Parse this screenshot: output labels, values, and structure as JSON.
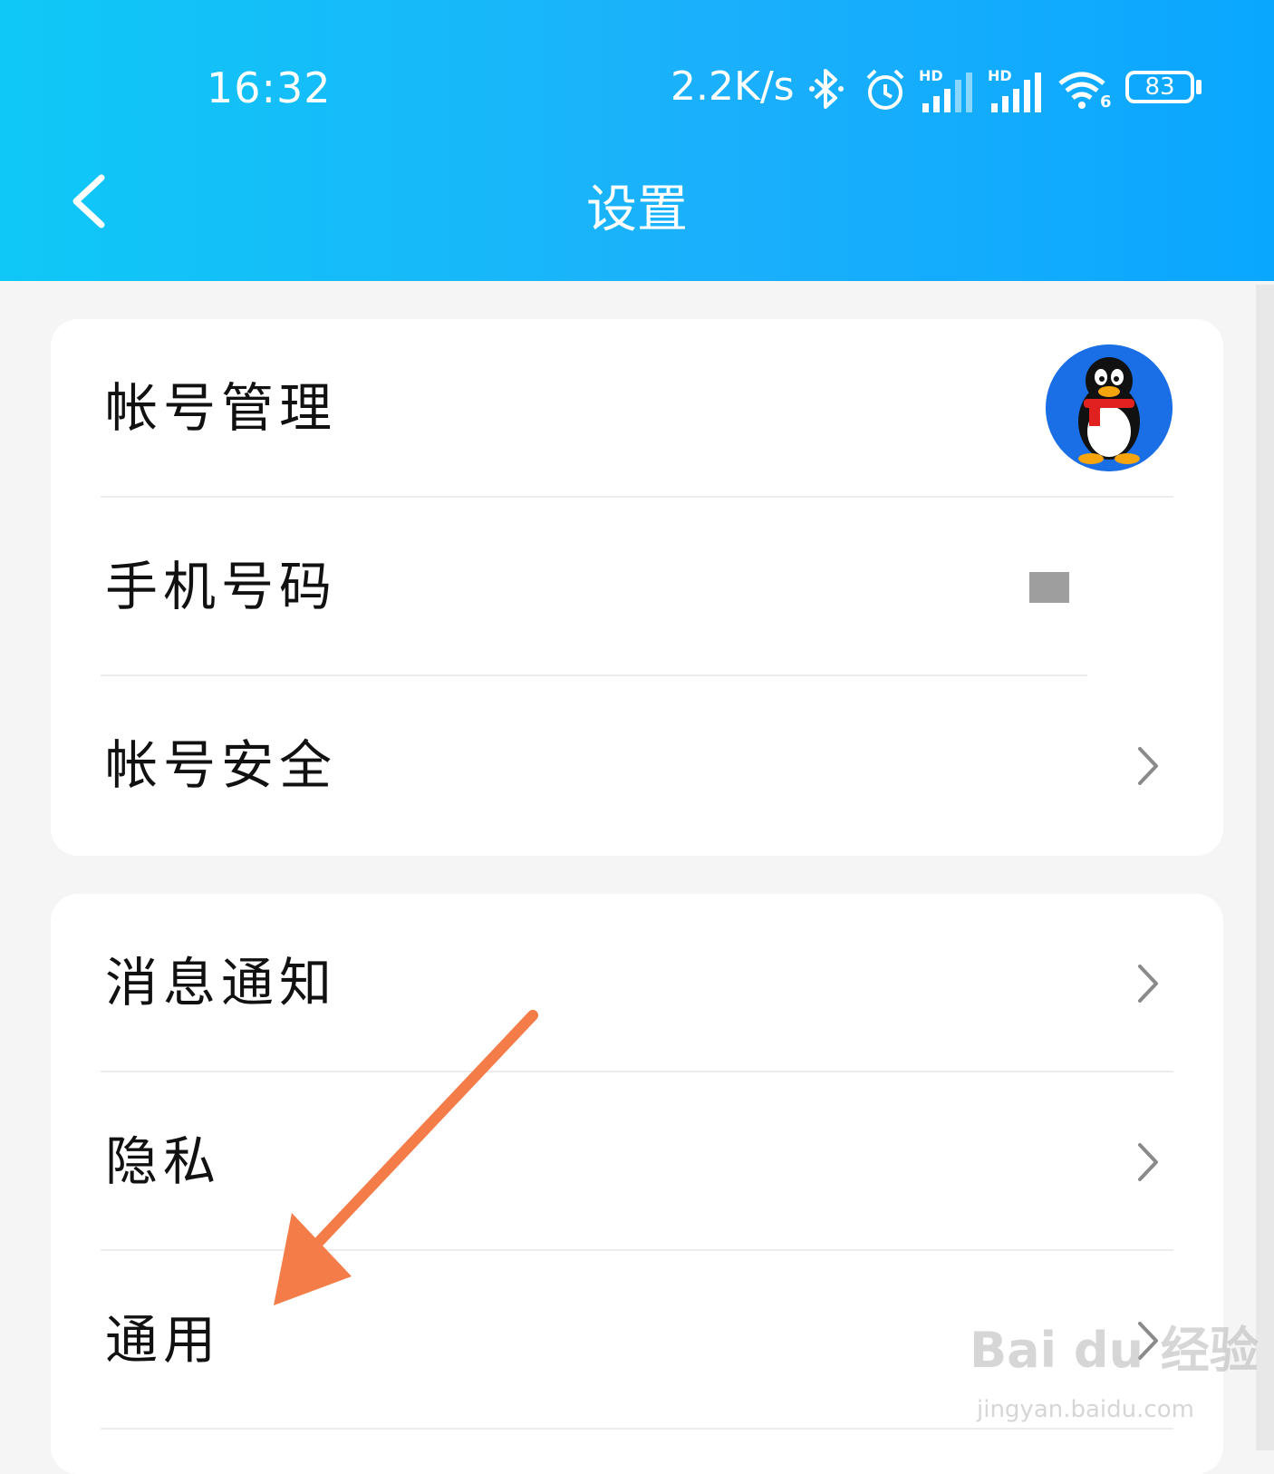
{
  "status_bar": {
    "time": "16:32",
    "network_speed": "2.2K/s",
    "battery_level": "83",
    "signal_badge_1": "HD",
    "signal_badge_2": "HD",
    "wifi_badge": "6"
  },
  "header": {
    "title": "设置",
    "accent_color": "#1bb0fb"
  },
  "account_group": [
    {
      "label": "帐号管理"
    },
    {
      "label": "手机号码"
    },
    {
      "label": "帐号安全"
    }
  ],
  "settings_group": [
    {
      "label": "消息通知"
    },
    {
      "label": "隐私"
    },
    {
      "label": "通用"
    }
  ],
  "annotation": {
    "arrow_color": "#f47c48"
  },
  "watermark": {
    "brand": "Bai du 经验",
    "url": "jingyan.baidu.com"
  }
}
